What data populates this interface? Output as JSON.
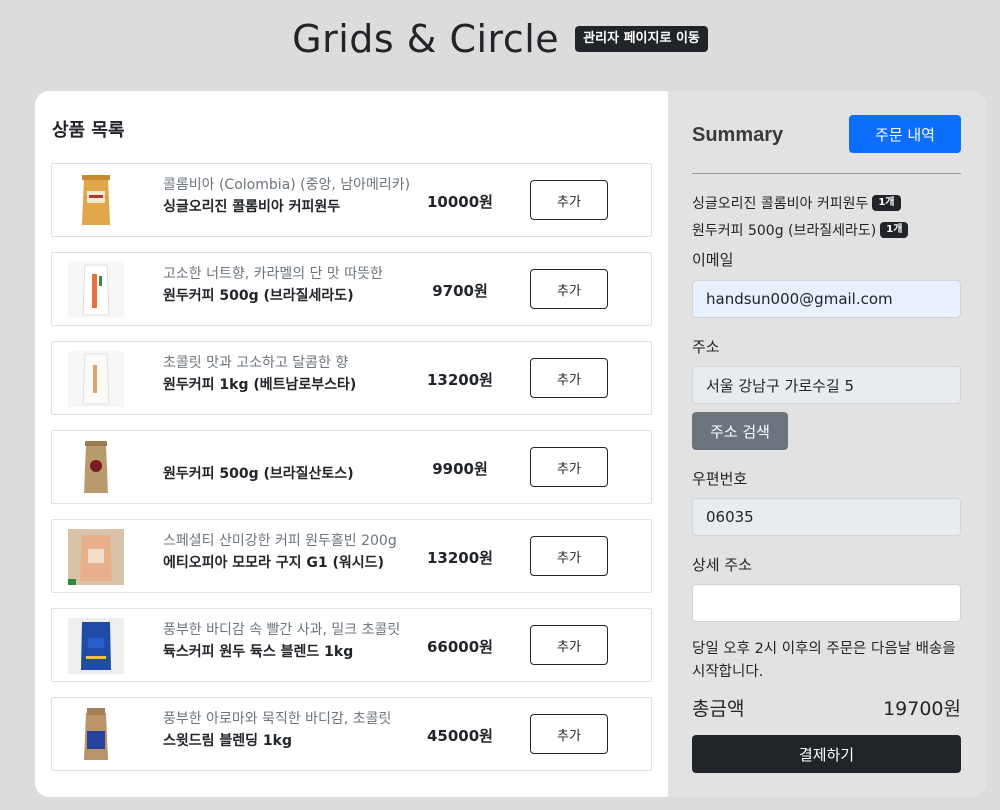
{
  "header": {
    "title": "Grids & Circle",
    "admin_link": "관리자 페이지로 이동"
  },
  "product_list": {
    "title": "상품 목록",
    "add_label": "추가",
    "items": [
      {
        "description": "콜롬비아 (Colombia) (중앙, 남아메리카)",
        "name": "싱글오리진 콜롬비아 커피원두",
        "price": "10000원",
        "image_icon": "coffee-bag-gold"
      },
      {
        "description": "고소한 너트향, 카라멜의 단 맛 따뜻한",
        "name": "원두커피 500g (브라질세라도)",
        "price": "9700원",
        "image_icon": "coffee-bag-white-orange"
      },
      {
        "description": "초콜릿 맛과 고소하고 달콤한 향",
        "name": "원두커피 1kg (베트남로부스타)",
        "price": "13200원",
        "image_icon": "coffee-bag-white"
      },
      {
        "description": "",
        "name": "원두커피 500g (브라질산토스)",
        "price": "9900원",
        "image_icon": "coffee-bag-kraft"
      },
      {
        "description": "스페셜티 산미강한 커피 원두홀빈 200g",
        "name": "에티오피아 모모라 구지 G1 (워시드)",
        "price": "13200원",
        "image_icon": "coffee-bag-pink"
      },
      {
        "description": "풍부한 바디감 속 빨간 사과, 밀크 초콜릿",
        "name": "듁스커피 원두 듁스 블렌드 1kg",
        "price": "66000원",
        "image_icon": "coffee-bag-blue"
      },
      {
        "description": "풍부한 아로마와 묵직한 바디감, 초콜릿",
        "name": "스윗드림 블렌딩 1kg",
        "price": "45000원",
        "image_icon": "coffee-bag-kraft-blue"
      }
    ]
  },
  "summary": {
    "title": "Summary",
    "order_history_button": "주문 내역",
    "order_items": [
      {
        "name": "싱글오리진 콜롬비아 커피원두",
        "qty": "1개"
      },
      {
        "name": "원두커피 500g (브라질세라도)",
        "qty": "1개"
      }
    ],
    "email_label": "이메일",
    "email_value": "handsun000@gmail.com",
    "address_label": "주소",
    "address_value": "서울 강남구 가로수길 5",
    "address_search_button": "주소 검색",
    "zipcode_label": "우편번호",
    "zipcode_value": "06035",
    "detail_address_label": "상세 주소",
    "detail_address_value": "",
    "notice": "당일 오후 2시 이후의 주문은 다음날 배송을 시작합니다.",
    "total_label": "총금액",
    "total_value": "19700원",
    "pay_button": "결제하기"
  },
  "colors": {
    "background": "#dcdcdc",
    "primary": "#0d6efd",
    "dark": "#212529",
    "secondary": "#6c757d"
  }
}
